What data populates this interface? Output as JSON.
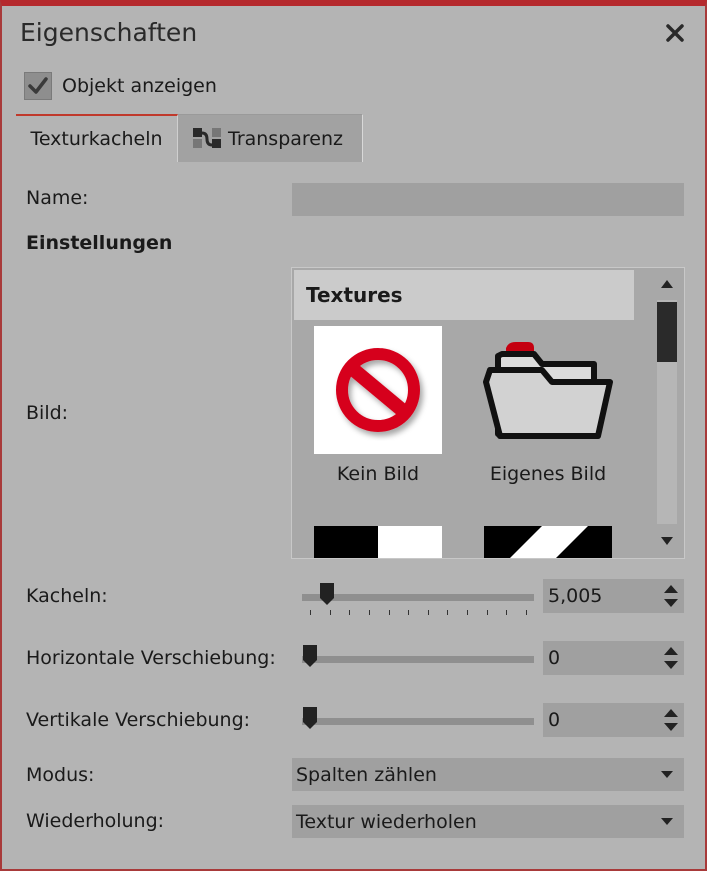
{
  "panel": {
    "title": "Eigenschaften"
  },
  "show_object": {
    "label": "Objekt anzeigen",
    "checked": true
  },
  "tabs": [
    {
      "label": "Texturkacheln",
      "active": true
    },
    {
      "label": "Transparenz",
      "active": false,
      "icon": "transparency-icon"
    }
  ],
  "form": {
    "name_label": "Name:",
    "name_value": "",
    "section_label": "Einstellungen",
    "image_label": "Bild:",
    "tiles_label": "Kacheln:",
    "h_shift_label": "Horizontale Verschiebung:",
    "v_shift_label": "Vertikale Verschiebung:",
    "mode_label": "Modus:",
    "repeat_label": "Wiederholung:"
  },
  "gallery": {
    "header": "Textures",
    "items": [
      {
        "label": "Kein Bild",
        "icon": "no-image-icon"
      },
      {
        "label": "Eigenes Bild",
        "icon": "folder-icon"
      },
      {
        "label": "",
        "icon": "black-white-split-texture"
      },
      {
        "label": "",
        "icon": "diagonal-stripe-texture"
      }
    ]
  },
  "tiles": {
    "value": "5,005",
    "slider_fraction": 0.08
  },
  "h_shift": {
    "value": "0",
    "slider_fraction": 0.0
  },
  "v_shift": {
    "value": "0",
    "slider_fraction": 0.0
  },
  "mode": {
    "value": "Spalten zählen"
  },
  "repeat": {
    "value": "Textur wiederholen"
  },
  "colors": {
    "accent": "#b5292d",
    "panel_bg": "#b4b4b4",
    "field_bg": "#a0a0a0"
  }
}
